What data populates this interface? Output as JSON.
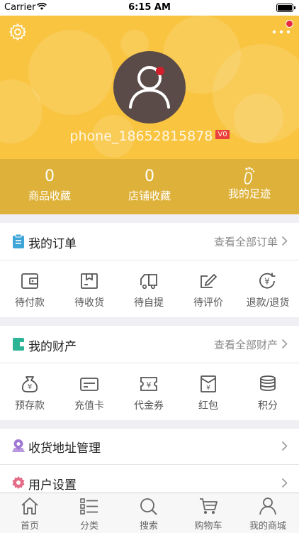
{
  "status_bar": {
    "carrier": "Carrier",
    "time": "6:15 AM"
  },
  "profile": {
    "username": "phone_18652815878",
    "vip_badge": "V0"
  },
  "stats": [
    {
      "value": "0",
      "label": "商品收藏"
    },
    {
      "value": "0",
      "label": "店铺收藏"
    },
    {
      "label": "我的足迹"
    }
  ],
  "orders": {
    "title": "我的订单",
    "link": "查看全部订单",
    "items": [
      {
        "label": "待付款",
        "icon": "wallet-icon"
      },
      {
        "label": "待收货",
        "icon": "package-icon"
      },
      {
        "label": "待自提",
        "icon": "truck-icon"
      },
      {
        "label": "待评价",
        "icon": "edit-icon"
      },
      {
        "label": "退款/退货",
        "icon": "refund-icon"
      }
    ]
  },
  "assets": {
    "title": "我的财产",
    "link": "查看全部财产",
    "items": [
      {
        "label": "预存款",
        "icon": "money-bag-icon"
      },
      {
        "label": "充值卡",
        "icon": "card-icon"
      },
      {
        "label": "代金券",
        "icon": "coupon-icon"
      },
      {
        "label": "红包",
        "icon": "red-envelope-icon"
      },
      {
        "label": "积分",
        "icon": "coins-icon"
      }
    ]
  },
  "menu_rows": [
    {
      "label": "收货地址管理",
      "icon": "location-icon"
    },
    {
      "label": "用户设置",
      "icon": "settings-icon"
    }
  ],
  "tabbar": [
    {
      "label": "首页",
      "icon": "home-icon"
    },
    {
      "label": "分类",
      "icon": "list-icon"
    },
    {
      "label": "搜索",
      "icon": "search-icon"
    },
    {
      "label": "购物车",
      "icon": "cart-icon"
    },
    {
      "label": "我的商城",
      "icon": "user-icon"
    }
  ],
  "colors": {
    "header": "#f9c440",
    "stats_band": "#deb23a",
    "accent_red": "#e8293d"
  }
}
